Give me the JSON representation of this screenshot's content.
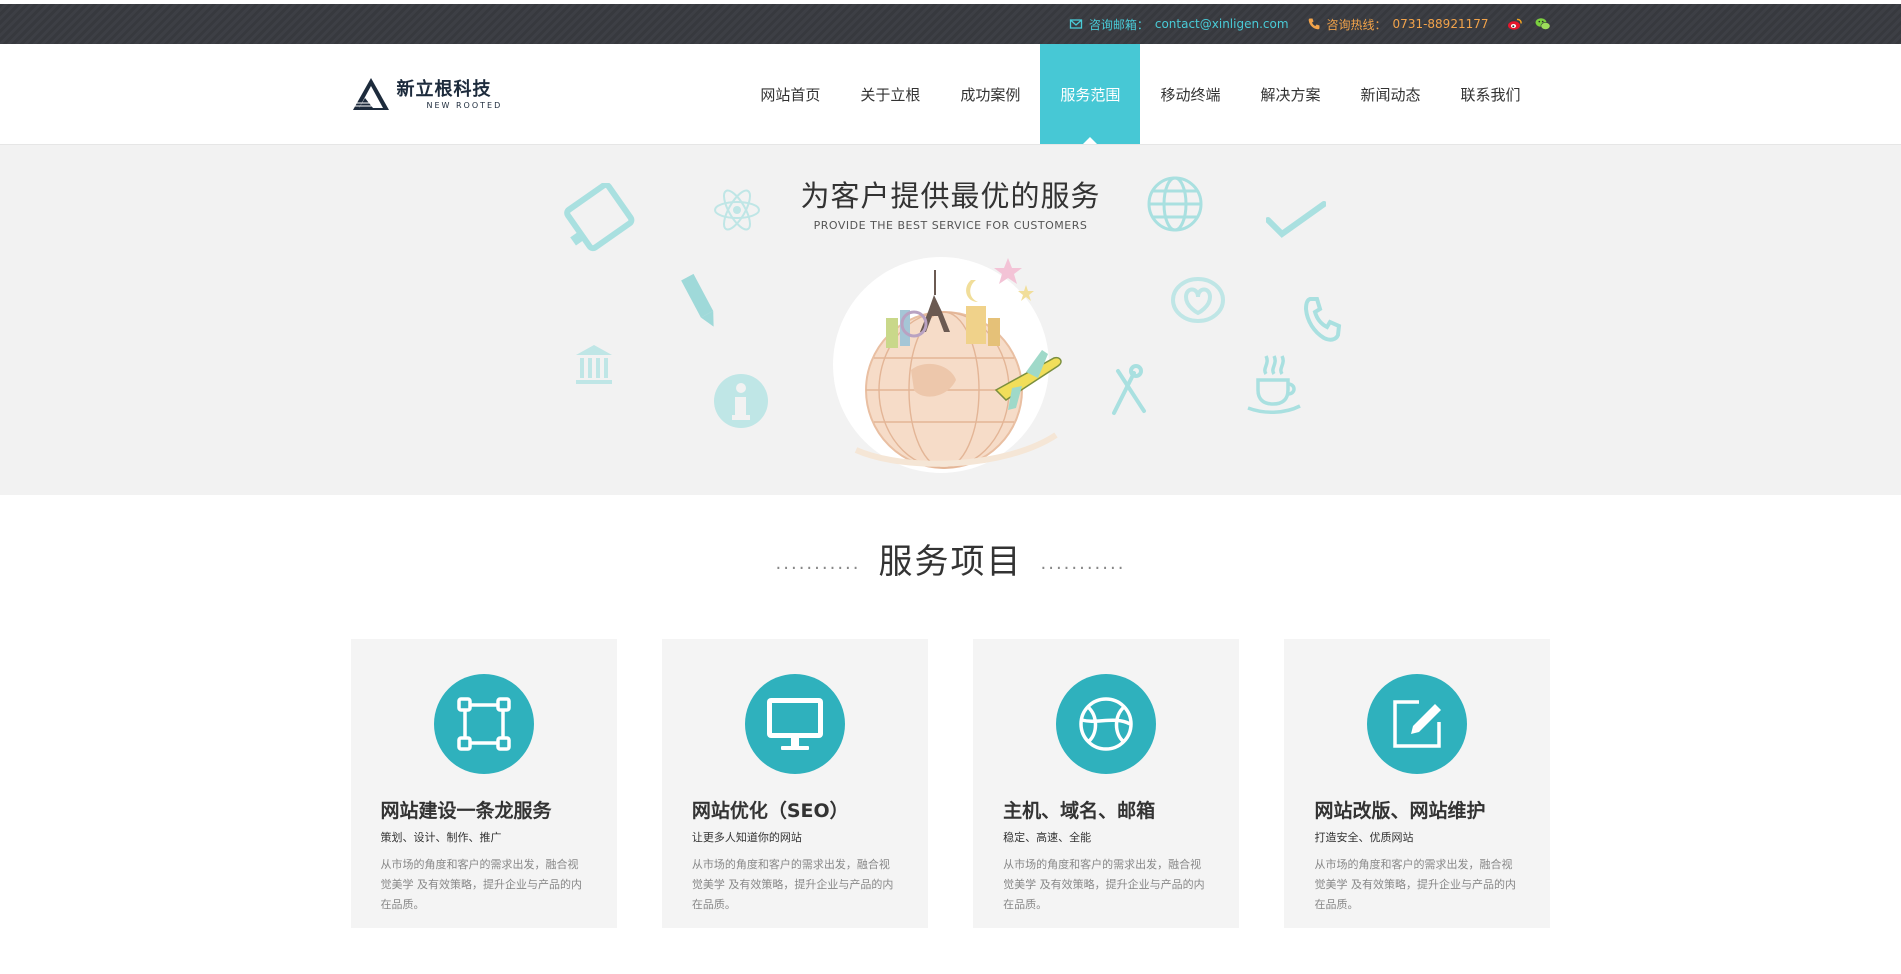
{
  "topbar": {
    "email_label": "咨询邮箱：",
    "email": "contact@xinligen.com",
    "phone_label": "咨询热线：",
    "phone": "0731-88921177"
  },
  "logo": {
    "cn": "新立根科技",
    "en": "NEW ROOTED"
  },
  "nav": [
    {
      "label": "网站首页"
    },
    {
      "label": "关于立根"
    },
    {
      "label": "成功案例"
    },
    {
      "label": "服务范围"
    },
    {
      "label": "移动终端"
    },
    {
      "label": "解决方案"
    },
    {
      "label": "新闻动态"
    },
    {
      "label": "联系我们"
    }
  ],
  "banner": {
    "title": "为客户提供最优的服务",
    "subtitle": "PROVIDE THE BEST SERVICE FOR CUSTOMERS"
  },
  "services": {
    "dots_left": "...........",
    "title": "服务项目",
    "dots_right": "...........",
    "cards": [
      {
        "icon": "frame-icon",
        "title": "网站建设一条龙服务",
        "sub": "策划、设计、制作、推广",
        "desc": "从市场的角度和客户的需求出发，融合视觉美学 及有效策略，提升企业与产品的内在品质。"
      },
      {
        "icon": "monitor-icon",
        "title": "网站优化（SEO）",
        "sub": "让更多人知道你的网站",
        "desc": "从市场的角度和客户的需求出发，融合视觉美学 及有效策略，提升企业与产品的内在品质。"
      },
      {
        "icon": "ball-icon",
        "title": "主机、域名、邮箱",
        "sub": "稳定、高速、全能",
        "desc": "从市场的角度和客户的需求出发，融合视觉美学 及有效策略，提升企业与产品的内在品质。"
      },
      {
        "icon": "edit-icon",
        "title": "网站改版、网站维护",
        "sub": "打造安全、优质网站",
        "desc": "从市场的角度和客户的需求出发，融合视觉美学 及有效策略，提升企业与产品的内在品质。"
      }
    ]
  },
  "colors": {
    "accent": "#47c8d5",
    "icon_circle": "#2fb1bd",
    "topbar_bg": "#3a3c41",
    "phone": "#f2a34a"
  }
}
